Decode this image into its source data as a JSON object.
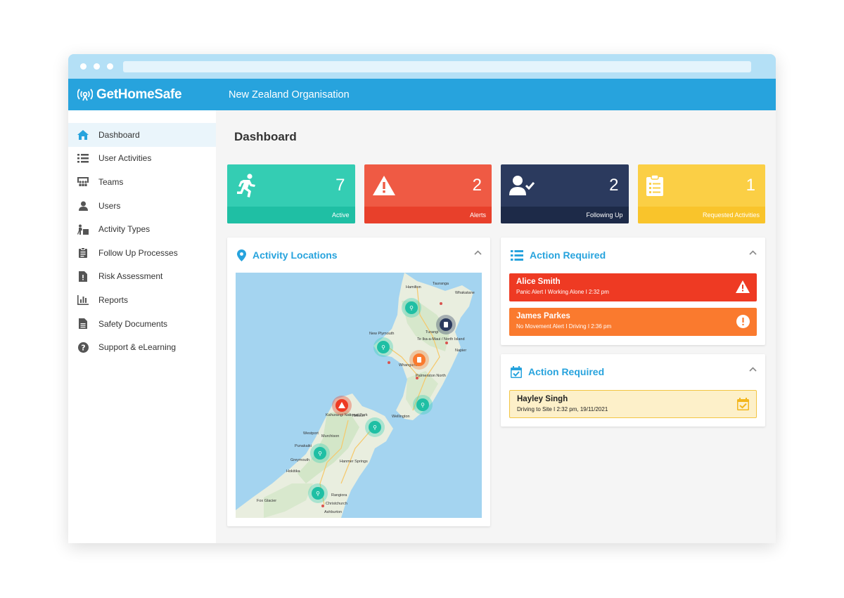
{
  "app": {
    "brand": "GetHomeSafe",
    "organisation": "New Zealand Organisation"
  },
  "sidebar": {
    "items": [
      {
        "label": "Dashboard",
        "icon": "home-icon",
        "active": true
      },
      {
        "label": "User Activities",
        "icon": "list-icon"
      },
      {
        "label": "Teams",
        "icon": "teams-icon"
      },
      {
        "label": "Users",
        "icon": "user-icon"
      },
      {
        "label": "Activity Types",
        "icon": "activity-types-icon"
      },
      {
        "label": "Follow Up Processes",
        "icon": "clipboard-icon"
      },
      {
        "label": "Risk Assessment",
        "icon": "risk-document-icon"
      },
      {
        "label": "Reports",
        "icon": "bar-chart-icon"
      },
      {
        "label": "Safety Documents",
        "icon": "document-icon"
      },
      {
        "label": "Support & eLearning",
        "icon": "question-icon"
      }
    ]
  },
  "main": {
    "title": "Dashboard",
    "stats": [
      {
        "value": "7",
        "label": "Active",
        "color": "#34cdb3",
        "band": "#1fbfa4",
        "icon": "running-person-icon"
      },
      {
        "value": "2",
        "label": "Alerts",
        "color": "#ef5a44",
        "band": "#e8402b",
        "icon": "warning-icon"
      },
      {
        "value": "2",
        "label": "Following Up",
        "color": "#2b3a5e",
        "band": "#1d2a48",
        "icon": "user-check-icon"
      },
      {
        "value": "1",
        "label": "Requested Activities",
        "color": "#fbcf45",
        "band": "#f9c42b",
        "icon": "clipboard-list-icon"
      }
    ],
    "locations": {
      "title": "Activity Locations",
      "map_labels": [
        "Hamilton",
        "Tauranga",
        "Whakatane",
        "New Plymouth",
        "Turangi",
        "Te Ika-a-Maui / North Island",
        "Napier",
        "Whanganui",
        "Palmerston North",
        "Wellington",
        "Nelson",
        "Kahurangi National Park",
        "Westport",
        "Murchison",
        "Punakaiki",
        "Greymouth",
        "Hanmer Springs",
        "Hokitika",
        "Rangiora",
        "Christchurch",
        "Fox Glacier",
        "Ashburton"
      ]
    },
    "action_required": {
      "title": "Action Required",
      "alerts": [
        {
          "name": "Alice Smith",
          "detail": "Panic Alert I Working Alone I 2:32 pm",
          "color": "#ee3a23",
          "icon": "warning-icon"
        },
        {
          "name": "James Parkes",
          "detail": "No Movement Alert I Driving I 2:36 pm",
          "color": "#fa7a2e",
          "icon": "exclamation-circle-icon"
        }
      ]
    },
    "requested": {
      "title": "Action Required",
      "items": [
        {
          "name": "Hayley Singh",
          "detail": "Driving to Site I 2:32 pm, 19/11/2021",
          "color": "#fdf0c9",
          "icon": "calendar-check-icon"
        }
      ]
    }
  }
}
